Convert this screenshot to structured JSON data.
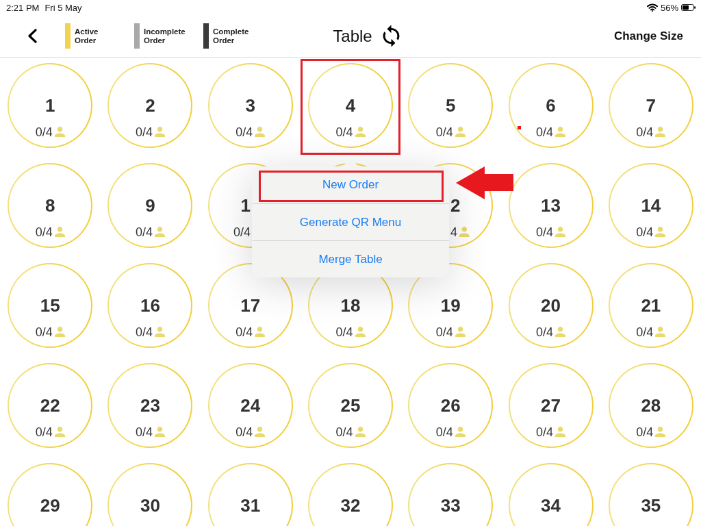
{
  "status_bar": {
    "time": "2:21 PM",
    "date": "Fri 5 May",
    "battery": "56%"
  },
  "header": {
    "legend": [
      {
        "label": "Active Order",
        "color": "#f2d34d"
      },
      {
        "label": "Incomplete Order",
        "color": "#a9a9a9"
      },
      {
        "label": "Complete Order",
        "color": "#3a3a3a"
      }
    ],
    "title": "Table",
    "action": "Change Size"
  },
  "tables": [
    {
      "number": "1",
      "seats": "0/4",
      "highlighted": false,
      "marked": false
    },
    {
      "number": "2",
      "seats": "0/4",
      "highlighted": false,
      "marked": false
    },
    {
      "number": "3",
      "seats": "0/4",
      "highlighted": false,
      "marked": false
    },
    {
      "number": "4",
      "seats": "0/4",
      "highlighted": true,
      "marked": false
    },
    {
      "number": "5",
      "seats": "0/4",
      "highlighted": false,
      "marked": false
    },
    {
      "number": "6",
      "seats": "0/4",
      "highlighted": false,
      "marked": true
    },
    {
      "number": "7",
      "seats": "0/4",
      "highlighted": false,
      "marked": false
    },
    {
      "number": "8",
      "seats": "0/4",
      "highlighted": false,
      "marked": false
    },
    {
      "number": "9",
      "seats": "0/4",
      "highlighted": false,
      "marked": false
    },
    {
      "number": "1",
      "seats": "0/4",
      "highlighted": false,
      "marked": false
    },
    {
      "highlighted": false,
      "marked": false
    },
    {
      "number": "2",
      "seats": "4",
      "highlighted": false,
      "marked": false
    },
    {
      "number": "13",
      "seats": "0/4",
      "highlighted": false,
      "marked": false
    },
    {
      "number": "14",
      "seats": "0/4",
      "highlighted": false,
      "marked": false
    },
    {
      "number": "15",
      "seats": "0/4",
      "highlighted": false,
      "marked": false
    },
    {
      "number": "16",
      "seats": "0/4",
      "highlighted": false,
      "marked": false
    },
    {
      "number": "17",
      "seats": "0/4",
      "highlighted": false,
      "marked": false
    },
    {
      "number": "18",
      "seats": "0/4",
      "highlighted": false,
      "marked": false
    },
    {
      "number": "19",
      "seats": "0/4",
      "highlighted": false,
      "marked": false
    },
    {
      "number": "20",
      "seats": "0/4",
      "highlighted": false,
      "marked": false
    },
    {
      "number": "21",
      "seats": "0/4",
      "highlighted": false,
      "marked": false
    },
    {
      "number": "22",
      "seats": "0/4",
      "highlighted": false,
      "marked": false
    },
    {
      "number": "23",
      "seats": "0/4",
      "highlighted": false,
      "marked": false
    },
    {
      "number": "24",
      "seats": "0/4",
      "highlighted": false,
      "marked": false
    },
    {
      "number": "25",
      "seats": "0/4",
      "highlighted": false,
      "marked": false
    },
    {
      "number": "26",
      "seats": "0/4",
      "highlighted": false,
      "marked": false
    },
    {
      "number": "27",
      "seats": "0/4",
      "highlighted": false,
      "marked": false
    },
    {
      "number": "28",
      "seats": "0/4",
      "highlighted": false,
      "marked": false
    },
    {
      "number": "29",
      "highlighted": false,
      "marked": false
    },
    {
      "number": "30",
      "highlighted": false,
      "marked": false
    },
    {
      "number": "31",
      "highlighted": false,
      "marked": false
    },
    {
      "number": "32",
      "highlighted": false,
      "marked": false
    },
    {
      "number": "33",
      "highlighted": false,
      "marked": false
    },
    {
      "number": "34",
      "highlighted": false,
      "marked": false
    },
    {
      "number": "35",
      "highlighted": false,
      "marked": false
    }
  ],
  "popover_menu": {
    "items": [
      {
        "label": "New Order",
        "highlighted": true
      },
      {
        "label": "Generate QR Menu",
        "highlighted": false
      },
      {
        "label": "Merge Table",
        "highlighted": false
      }
    ]
  }
}
